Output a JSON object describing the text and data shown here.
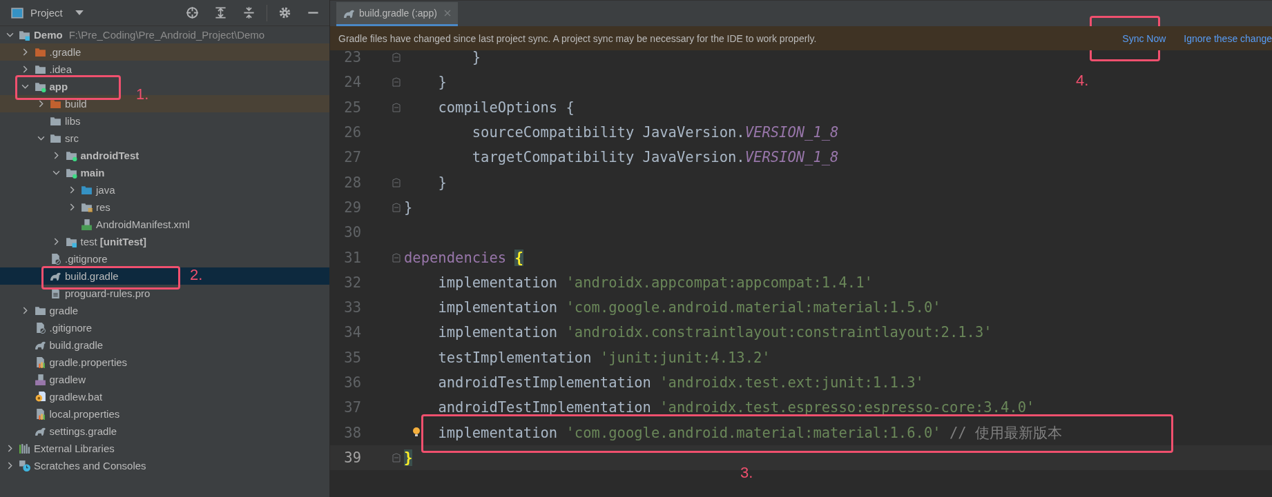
{
  "project_panel": {
    "title": "Project",
    "tree": [
      {
        "label": "Demo",
        "kind": "module-root",
        "bold": true,
        "hint": "F:\\Pre_Coding\\Pre_Android_Project\\Demo",
        "expanded": true,
        "selected": false,
        "excluded": false,
        "children": [
          {
            "label": ".gradle",
            "kind": "folder-excluded",
            "expanded": false,
            "selected": false,
            "excluded": true
          },
          {
            "label": ".idea",
            "kind": "folder",
            "expanded": false,
            "selected": false,
            "excluded": false
          },
          {
            "label": "app",
            "kind": "module",
            "bold": true,
            "expanded": true,
            "selected": false,
            "excluded": false,
            "children": [
              {
                "label": "build",
                "kind": "folder-excluded",
                "expanded": false,
                "selected": false,
                "excluded": true
              },
              {
                "label": "libs",
                "kind": "folder",
                "selected": false,
                "excluded": false
              },
              {
                "label": "src",
                "kind": "folder",
                "expanded": true,
                "selected": false,
                "excluded": false,
                "children": [
                  {
                    "label": "androidTest",
                    "kind": "module",
                    "bold": true,
                    "expanded": false,
                    "selected": false,
                    "excluded": false
                  },
                  {
                    "label": "main",
                    "kind": "module",
                    "bold": true,
                    "expanded": true,
                    "selected": false,
                    "excluded": false,
                    "children": [
                      {
                        "label": "java",
                        "kind": "source",
                        "expanded": false,
                        "selected": false,
                        "excluded": false
                      },
                      {
                        "label": "res",
                        "kind": "resources",
                        "expanded": false,
                        "selected": false,
                        "excluded": false
                      },
                      {
                        "label": "AndroidManifest.xml",
                        "kind": "manifest",
                        "selected": false,
                        "excluded": false
                      }
                    ]
                  },
                  {
                    "label": "test **[unitTest]**",
                    "kind": "test-folder",
                    "expanded": false,
                    "selected": false,
                    "excluded": false
                  }
                ]
              },
              {
                "label": ".gitignore",
                "kind": "ignore",
                "selected": false,
                "excluded": false
              },
              {
                "label": "build.gradle",
                "kind": "gradle",
                "selected": true,
                "excluded": false
              },
              {
                "label": "proguard-rules.pro",
                "kind": "text",
                "selected": false,
                "excluded": false
              }
            ]
          },
          {
            "label": "gradle",
            "kind": "folder",
            "expanded": false,
            "selected": false,
            "excluded": false
          },
          {
            "label": ".gitignore",
            "kind": "ignore",
            "selected": false,
            "excluded": false
          },
          {
            "label": "build.gradle",
            "kind": "gradle",
            "selected": false,
            "excluded": false
          },
          {
            "label": "gradle.properties",
            "kind": "properties",
            "selected": false,
            "excluded": false
          },
          {
            "label": "gradlew",
            "kind": "shell",
            "selected": false,
            "excluded": false
          },
          {
            "label": "gradlew.bat",
            "kind": "bat",
            "selected": false,
            "excluded": false
          },
          {
            "label": "local.properties",
            "kind": "properties",
            "selected": false,
            "excluded": false
          },
          {
            "label": "settings.gradle",
            "kind": "gradle",
            "selected": false,
            "excluded": false
          }
        ]
      },
      {
        "label": "External Libraries",
        "kind": "libraries",
        "expanded": false,
        "selected": false,
        "excluded": false
      },
      {
        "label": "Scratches and Consoles",
        "kind": "scratches",
        "expanded": false,
        "selected": false,
        "excluded": false
      }
    ]
  },
  "editor": {
    "tabs": [
      {
        "label": "build.gradle (:app)",
        "selected": true
      }
    ],
    "notification": {
      "message": "Gradle files have changed since last project sync. A project sync may be necessary for the IDE to work properly.",
      "actions": [
        "Sync Now",
        "Ignore these change"
      ]
    },
    "lines": [
      {
        "number": "23",
        "fold": true,
        "bulb": false,
        "current": false,
        "tokens": [
          {
            "kind": "plain",
            "text": "        }"
          }
        ]
      },
      {
        "number": "24",
        "fold": true,
        "bulb": false,
        "current": false,
        "tokens": [
          {
            "kind": "plain",
            "text": "    }"
          }
        ]
      },
      {
        "number": "25",
        "fold": true,
        "bulb": false,
        "current": false,
        "tokens": [
          {
            "kind": "plain",
            "text": "    compileOptions {"
          }
        ]
      },
      {
        "number": "26",
        "fold": false,
        "bulb": false,
        "current": false,
        "tokens": [
          {
            "kind": "plain",
            "text": "        sourceCompatibility JavaVersion."
          },
          {
            "kind": "constant",
            "text": "VERSION_1_8"
          }
        ]
      },
      {
        "number": "27",
        "fold": false,
        "bulb": false,
        "current": false,
        "tokens": [
          {
            "kind": "plain",
            "text": "        targetCompatibility JavaVersion."
          },
          {
            "kind": "constant",
            "text": "VERSION_1_8"
          }
        ]
      },
      {
        "number": "28",
        "fold": true,
        "bulb": false,
        "current": false,
        "tokens": [
          {
            "kind": "plain",
            "text": "    }"
          }
        ]
      },
      {
        "number": "29",
        "fold": true,
        "bulb": false,
        "current": false,
        "tokens": [
          {
            "kind": "plain",
            "text": "}"
          }
        ]
      },
      {
        "number": "30",
        "fold": false,
        "bulb": false,
        "current": false
      },
      {
        "number": "31",
        "fold": true,
        "bulb": false,
        "current": false,
        "tokens": [
          {
            "kind": "keyword",
            "text": "dependencies"
          },
          {
            "kind": "brace-match",
            "text": "{"
          }
        ]
      },
      {
        "number": "32",
        "fold": false,
        "bulb": false,
        "current": false,
        "tokens": [
          {
            "kind": "plain",
            "text": "    implementation "
          },
          {
            "kind": "string",
            "text": "'androidx.appcompat:appcompat:1.4.1'"
          }
        ]
      },
      {
        "number": "33",
        "fold": false,
        "bulb": false,
        "current": false,
        "tokens": [
          {
            "kind": "plain",
            "text": "    implementation "
          },
          {
            "kind": "string",
            "text": "'com.google.android.material:material:1.5.0'"
          }
        ]
      },
      {
        "number": "34",
        "fold": false,
        "bulb": false,
        "current": false,
        "tokens": [
          {
            "kind": "plain",
            "text": "    implementation "
          },
          {
            "kind": "string",
            "text": "'androidx.constraintlayout:constraintlayout:2.1.3'"
          }
        ]
      },
      {
        "number": "35",
        "fold": false,
        "bulb": false,
        "current": false,
        "tokens": [
          {
            "kind": "plain",
            "text": "    testImplementation "
          },
          {
            "kind": "string",
            "text": "'junit:junit:4.13.2'"
          }
        ]
      },
      {
        "number": "36",
        "fold": false,
        "bulb": false,
        "current": false,
        "tokens": [
          {
            "kind": "plain",
            "text": "    androidTestImplementation "
          },
          {
            "kind": "string",
            "text": "'androidx.test.ext:junit:1.1.3'"
          }
        ]
      },
      {
        "number": "37",
        "fold": false,
        "bulb": false,
        "current": false,
        "tokens": [
          {
            "kind": "plain",
            "text": "    androidTestImplementation "
          },
          {
            "kind": "string",
            "text": "'androidx.test.espresso:espresso-core:3.4.0'"
          }
        ]
      },
      {
        "number": "38",
        "fold": false,
        "bulb": true,
        "current": false,
        "tokens": [
          {
            "kind": "plain",
            "text": "    implementation "
          },
          {
            "kind": "string",
            "text": "'com.google.android.material:material:1.6.0'"
          },
          {
            "kind": "comment",
            "text": "// 使用最新版本"
          }
        ]
      },
      {
        "number": "39",
        "fold": true,
        "bulb": false,
        "current": true,
        "tokens": [
          {
            "kind": "brace-match",
            "text": "}"
          }
        ]
      }
    ]
  },
  "annotations": [
    {
      "label": "1."
    },
    {
      "label": "2."
    },
    {
      "label": "3."
    },
    {
      "label": "4."
    }
  ]
}
